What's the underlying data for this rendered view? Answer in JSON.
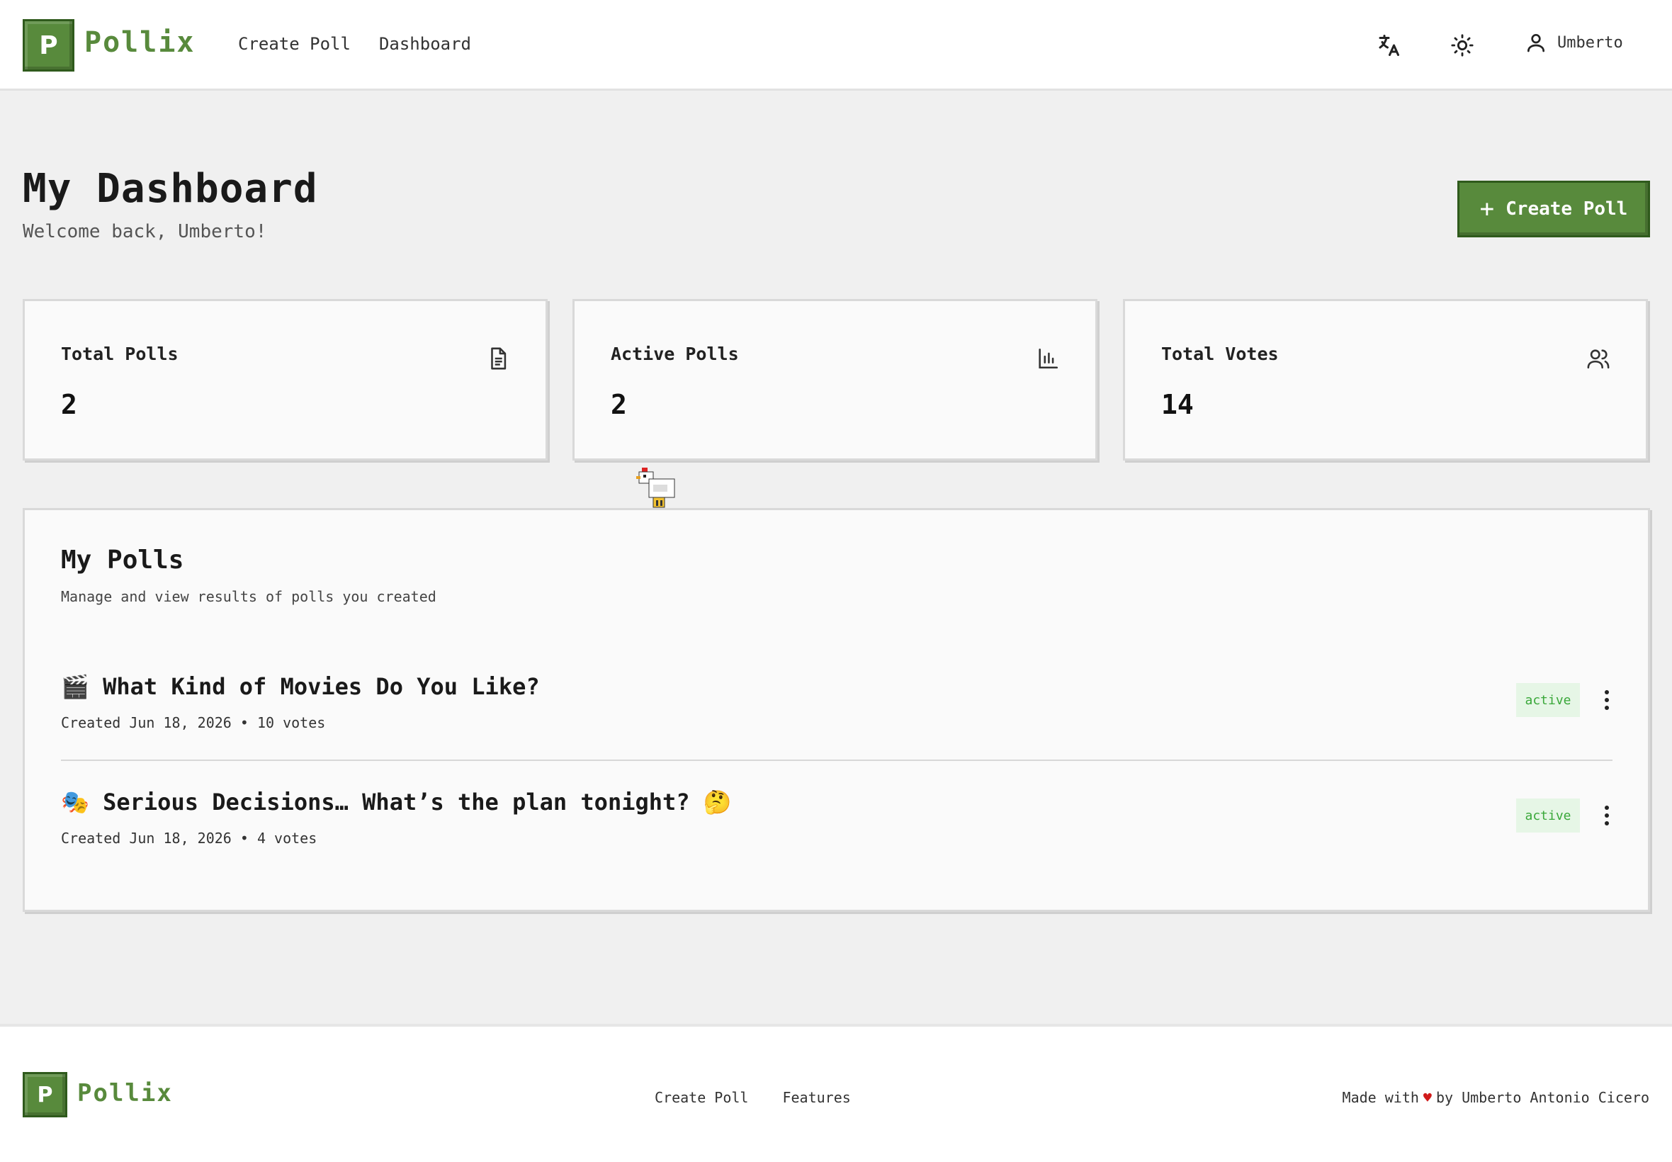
{
  "brand": {
    "logo_letter": "P",
    "name": "Pollix",
    "color": "#588a3c"
  },
  "nav": {
    "create_poll": "Create Poll",
    "dashboard": "Dashboard"
  },
  "header": {
    "translate_icon": "translate-icon",
    "theme_icon": "sun-icon",
    "user_name": "Umberto"
  },
  "page": {
    "title": "My Dashboard",
    "welcome": "Welcome back, Umberto!",
    "create_button": "Create Poll"
  },
  "stats": [
    {
      "label": "Total Polls",
      "value": "2",
      "icon": "document-icon"
    },
    {
      "label": "Active Polls",
      "value": "2",
      "icon": "bar-chart-icon"
    },
    {
      "label": "Total Votes",
      "value": "14",
      "icon": "users-icon"
    }
  ],
  "polls": {
    "title": "My Polls",
    "subtitle": "Manage and view results of polls you created",
    "items": [
      {
        "emoji": "🎬",
        "title": "What Kind of Movies Do You Like?",
        "meta": "Created Jun 18, 2026 • 10 votes",
        "status": "active"
      },
      {
        "emoji": "🎭",
        "title": "Serious Decisions… What’s the plan tonight? 🤔",
        "meta": "Created Jun 18, 2026 • 4 votes",
        "status": "active"
      }
    ]
  },
  "footer": {
    "links": {
      "create_poll": "Create Poll",
      "features": "Features"
    },
    "credit_prefix": "Made with",
    "heart": "♥",
    "credit_suffix": "by Umberto Antonio Cicero"
  },
  "colors": {
    "accent": "#588a3c",
    "active_badge_bg": "#e6f6e6",
    "active_badge_text": "#3aa83a",
    "heart": "#d11a1a"
  }
}
